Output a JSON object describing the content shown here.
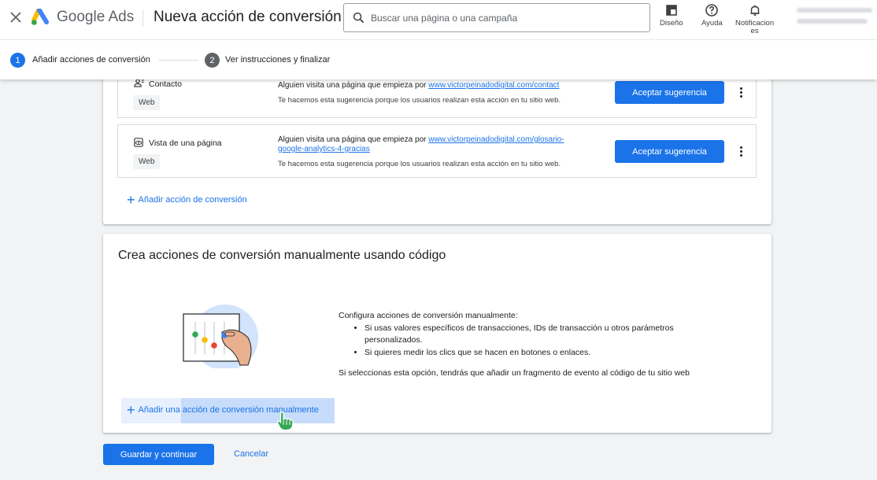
{
  "header": {
    "logo_text": "Google Ads",
    "page_title": "Nueva acción de conversión",
    "search_placeholder": "Buscar una página o una campaña",
    "tools": {
      "design_label": "Diseño",
      "help_label": "Ayuda",
      "notifications_label_1": "Notificacion",
      "notifications_label_2": "es"
    }
  },
  "stepper": {
    "step1_num": "1",
    "step1_label": "Añadir acciones de conversión",
    "step2_num": "2",
    "step2_label": "Ver instrucciones y finalizar"
  },
  "suggestions": [
    {
      "name": "Contacto",
      "chip": "Web",
      "desc_prefix": "Alguien visita una página que empieza por ",
      "url_line1": "www.victorpeinadodigital.com/contact",
      "url_line2": "",
      "note": "Te hacemos esta sugerencia porque los usuarios realizan esta acción en tu sitio web.",
      "accept_label": "Aceptar sugerencia"
    },
    {
      "name": "Vista de una página",
      "chip": "Web",
      "desc_prefix": "Alguien visita una página que empieza por ",
      "url_line1": "www.victorpeinadodigital.com/glosario-",
      "url_line2": "google-analytics-4-gracias",
      "note": "Te hacemos esta sugerencia porque los usuarios realizan esta acción en tu sitio web.",
      "accept_label": "Aceptar sugerencia"
    }
  ],
  "add_conversion_label": "Añadir acción de conversión",
  "manual": {
    "title": "Crea acciones de conversión manualmente usando código",
    "intro": "Configura acciones de conversión manualmente:",
    "bullets": [
      "Si usas valores específicos de transacciones, IDs de transacción u otros parámetros personalizados.",
      "Si quieres medir los clics que se hacen en botones o enlaces."
    ],
    "footer": "Si seleccionas esta opción, tendrás que añadir un fragmento de evento al código de tu sitio web",
    "add_manual_label": "Añadir una acción de conversión manualmente"
  },
  "actions": {
    "save_label": "Guardar y continuar",
    "cancel_label": "Cancelar"
  },
  "colors": {
    "primary": "#1a73e8",
    "background": "#f1f3f4"
  }
}
